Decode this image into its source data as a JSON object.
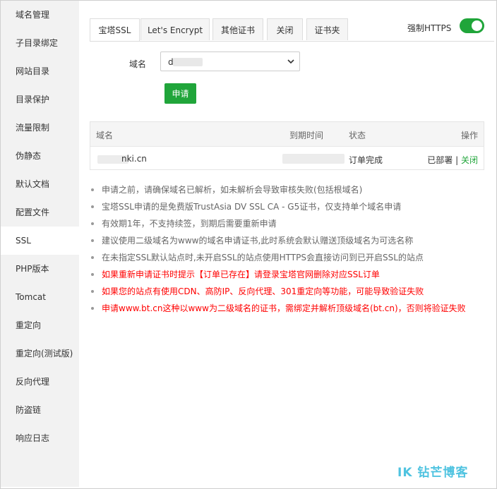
{
  "sidebar": {
    "items": [
      {
        "label": "域名管理"
      },
      {
        "label": "子目录绑定"
      },
      {
        "label": "网站目录"
      },
      {
        "label": "目录保护"
      },
      {
        "label": "流量限制"
      },
      {
        "label": "伪静态"
      },
      {
        "label": "默认文档"
      },
      {
        "label": "配置文件"
      },
      {
        "label": "SSL"
      },
      {
        "label": "PHP版本"
      },
      {
        "label": "Tomcat"
      },
      {
        "label": "重定向"
      },
      {
        "label": "重定向(测试版)"
      },
      {
        "label": "反向代理"
      },
      {
        "label": "防盗链"
      },
      {
        "label": "响应日志"
      }
    ],
    "active": "SSL"
  },
  "tabs": [
    {
      "label": "宝塔SSL",
      "active": true
    },
    {
      "label": "Let's Encrypt",
      "active": false
    },
    {
      "label": "其他证书",
      "active": false
    },
    {
      "label": "关闭",
      "active": false
    },
    {
      "label": "证书夹",
      "active": false
    }
  ],
  "force_https": {
    "label": "强制HTTPS",
    "enabled": true
  },
  "domain_field": {
    "label": "域名",
    "value": "d          :n"
  },
  "apply_button": "申请",
  "table": {
    "headers": {
      "domain": "域名",
      "expiry": "到期时间",
      "status": "状态",
      "action": "操作"
    },
    "rows": [
      {
        "domain": "nki.cn",
        "expiry": "",
        "status": "订单完成",
        "deployed": "已部署",
        "separator": "|",
        "close": "关闭"
      }
    ]
  },
  "notes": [
    {
      "text": "申请之前，请确保域名已解析，如未解析会导致审核失败(包括根域名)",
      "warn": false
    },
    {
      "text": "宝塔SSL申请的是免费版TrustAsia DV SSL CA - G5证书，仅支持单个域名申请",
      "warn": false
    },
    {
      "text": "有效期1年，不支持续签，到期后需要重新申请",
      "warn": false
    },
    {
      "text": "建议使用二级域名为www的域名申请证书,此时系统会默认赠送顶级域名为可选名称",
      "warn": false
    },
    {
      "text": "在未指定SSL默认站点时,未开启SSL的站点使用HTTPS会直接访问到已开启SSL的站点",
      "warn": false
    },
    {
      "text": "如果重新申请证书时提示【订单已存在】请登录宝塔官网删除对应SSL订单",
      "warn": true
    },
    {
      "text": "如果您的站点有使用CDN、高防IP、反向代理、301重定向等功能，可能导致验证失败",
      "warn": true
    },
    {
      "text": "申请www.bt.cn这种以www为二级域名的证书，需绑定并解析顶级域名(bt.cn)，否则将验证失败",
      "warn": true
    }
  ],
  "watermark": "IK 钻芒博客",
  "colors": {
    "accent": "#20a53a",
    "warning": "#ff0000"
  }
}
